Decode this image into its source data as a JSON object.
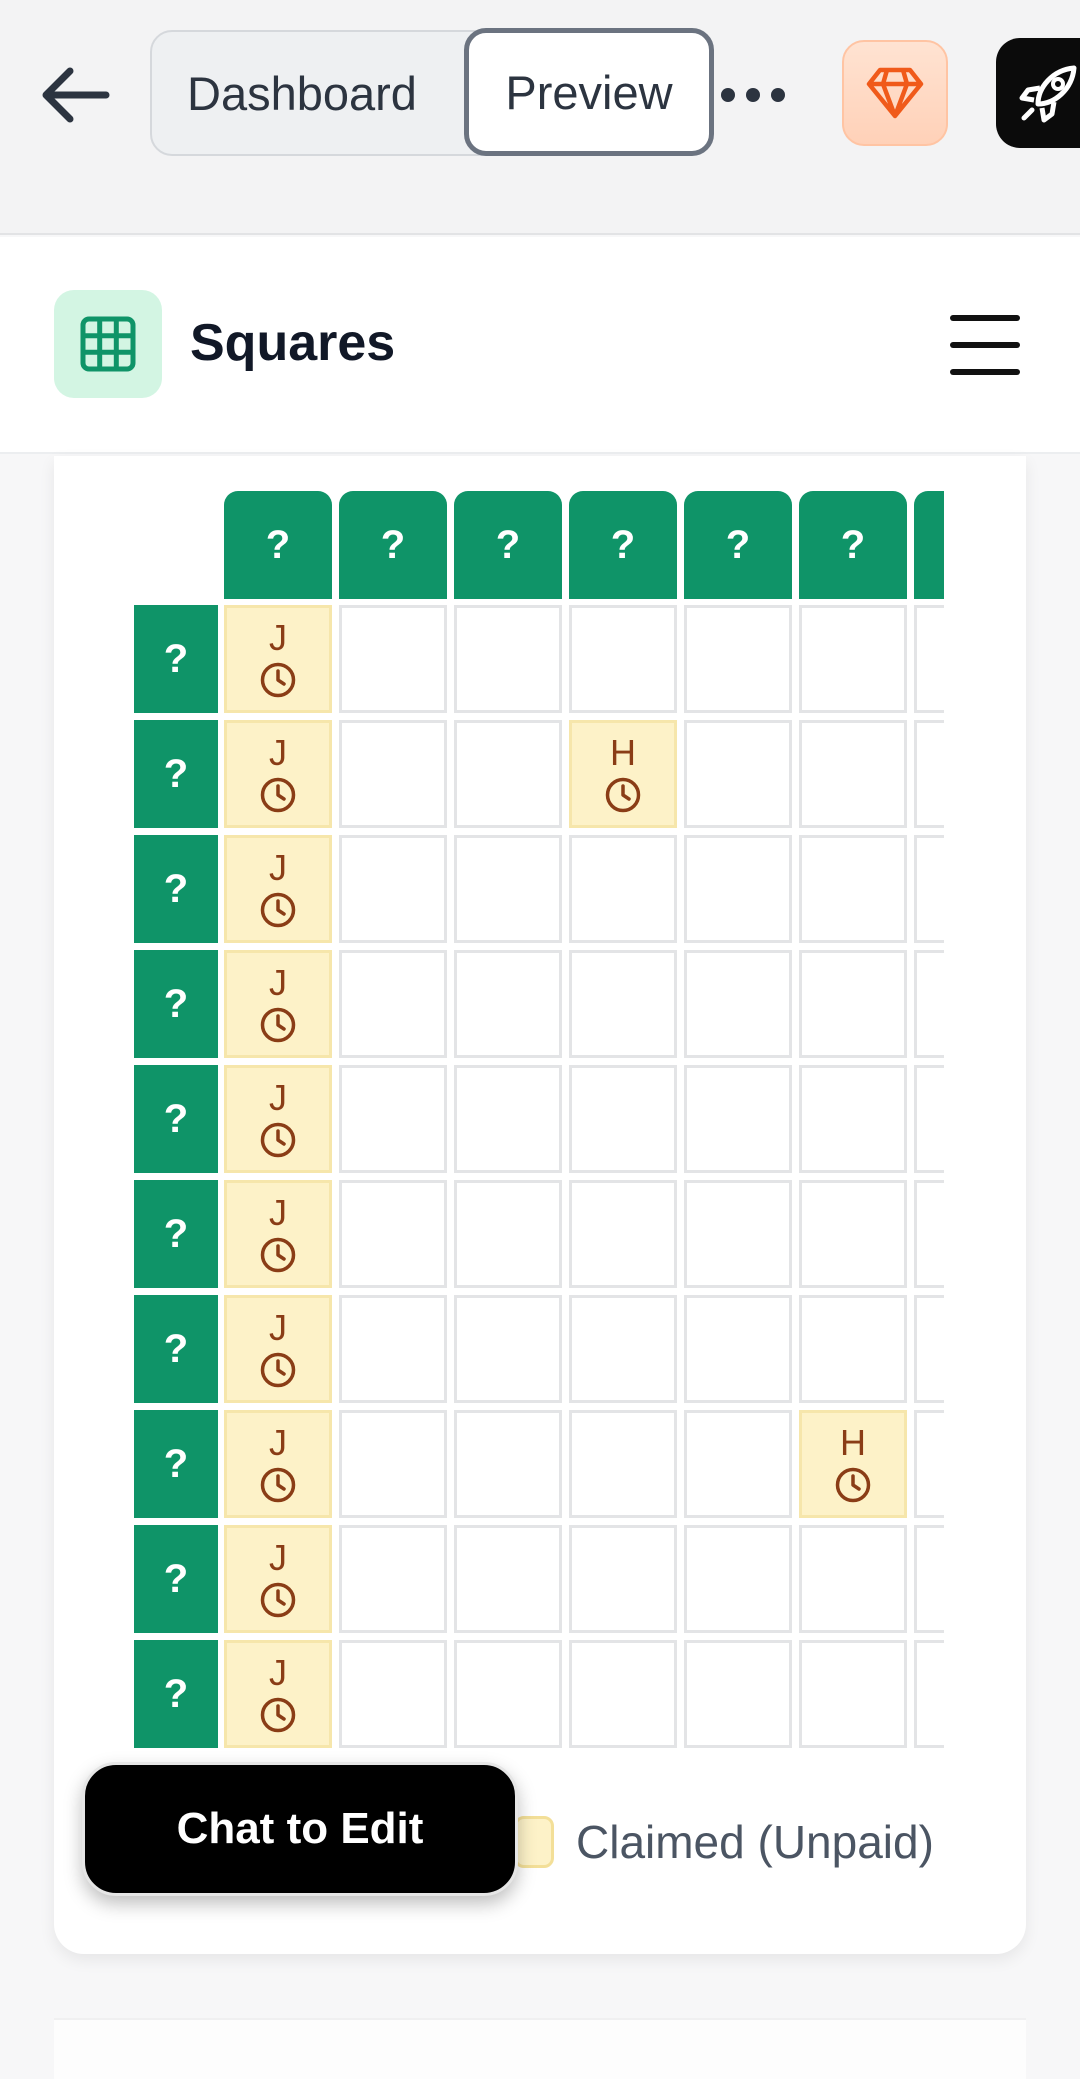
{
  "topbar": {
    "dashboard_label": "Dashboard",
    "preview_label": "Preview",
    "back_icon": "arrow-left-icon",
    "more_icon": "more-horizontal-icon",
    "gem_icon": "gem-icon",
    "rocket_icon": "rocket-icon"
  },
  "app": {
    "title": "Squares",
    "logo_icon": "grid-icon",
    "menu_icon": "hamburger-menu-icon",
    "accent": "#0f9468"
  },
  "grid": {
    "column_headers": [
      "?",
      "?",
      "?",
      "?",
      "?",
      "?",
      "?"
    ],
    "row_headers": [
      "?",
      "?",
      "?",
      "?",
      "?",
      "?",
      "?",
      "?",
      "?",
      "?"
    ],
    "claimed": [
      {
        "row": 0,
        "col": 0,
        "initial": "J"
      },
      {
        "row": 1,
        "col": 0,
        "initial": "J"
      },
      {
        "row": 1,
        "col": 3,
        "initial": "H"
      },
      {
        "row": 2,
        "col": 0,
        "initial": "J"
      },
      {
        "row": 3,
        "col": 0,
        "initial": "J"
      },
      {
        "row": 4,
        "col": 0,
        "initial": "J"
      },
      {
        "row": 5,
        "col": 0,
        "initial": "J"
      },
      {
        "row": 6,
        "col": 0,
        "initial": "J"
      },
      {
        "row": 7,
        "col": 0,
        "initial": "J"
      },
      {
        "row": 7,
        "col": 5,
        "initial": "H"
      },
      {
        "row": 8,
        "col": 0,
        "initial": "J"
      },
      {
        "row": 9,
        "col": 0,
        "initial": "J"
      }
    ],
    "claimed_color": "#fdf2c8"
  },
  "legend": {
    "claimed_unpaid_label": "Claimed (Unpaid)"
  },
  "chat_button": {
    "label": "Chat to Edit"
  }
}
